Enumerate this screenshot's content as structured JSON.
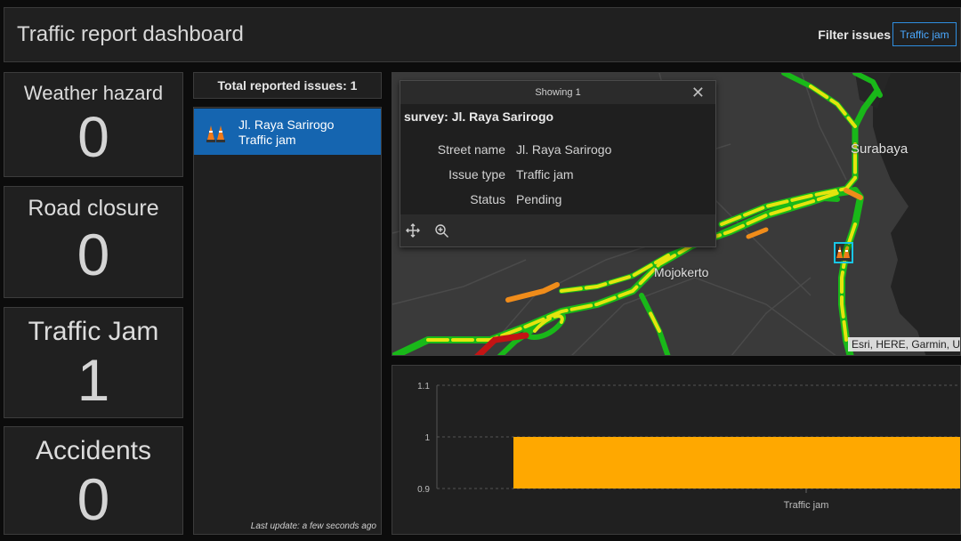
{
  "header": {
    "title": "Traffic report dashboard",
    "filter_label": "Filter issues",
    "filter_value": "Traffic jam"
  },
  "indicators": [
    {
      "label": "Weather hazard",
      "value": "0"
    },
    {
      "label": "Road closure",
      "value": "0"
    },
    {
      "label": "Traffic Jam",
      "value": "1"
    },
    {
      "label": "Accidents",
      "value": "0"
    }
  ],
  "list": {
    "header": "Total reported issues: 1",
    "items": [
      {
        "line1": "Jl. Raya Sarirogo",
        "line2": "Traffic jam",
        "icon": "traffic-cone-icon"
      }
    ],
    "last_update": "Last update: a few seconds ago"
  },
  "map": {
    "cities": [
      "Surabaya",
      "Mojokerto"
    ],
    "attribution": "Esri, HERE, Garmin, U",
    "popup": {
      "showing": "Showing 1",
      "title": "survey: Jl. Raya Sarirogo",
      "fields": [
        {
          "key": "Street name",
          "value": "Jl. Raya Sarirogo"
        },
        {
          "key": "Issue type",
          "value": "Traffic jam"
        },
        {
          "key": "Status",
          "value": "Pending"
        }
      ],
      "tools": [
        "pan-icon",
        "zoom-to-icon"
      ]
    },
    "colors": {
      "fast": "#19b819",
      "moderate": "#e4e40e",
      "slow": "#f08c1a",
      "stopped": "#c41414",
      "highlight": "#19c6e6"
    }
  },
  "chart_data": {
    "type": "bar",
    "categories": [
      "Traffic jam"
    ],
    "values": [
      1
    ],
    "ylim": [
      0.9,
      1.1
    ],
    "yticks": [
      0.9,
      1,
      1.1
    ],
    "color": "#ffa800",
    "grid": true
  }
}
